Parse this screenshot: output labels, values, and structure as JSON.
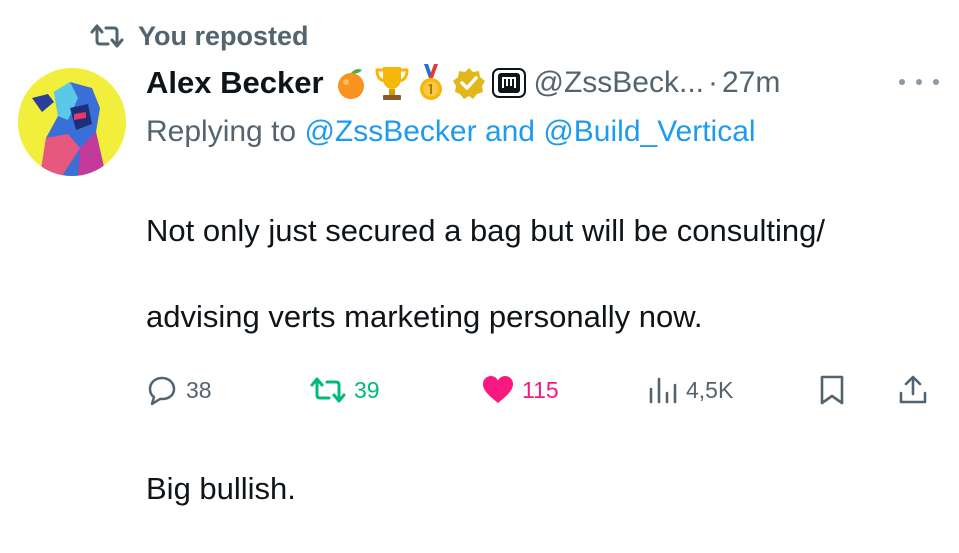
{
  "repost_banner": {
    "icon": "repost-icon",
    "label": "You reposted"
  },
  "tweet": {
    "author": {
      "name": "Alex Becker",
      "handle": "@ZssBeck...",
      "badges": [
        "orange-emoji",
        "trophy-emoji",
        "medal-emoji",
        "verified-badge",
        "affiliate-badge"
      ]
    },
    "dot": "·",
    "time": "27m",
    "replying": {
      "prefix": "Replying to",
      "user1": "@ZssBecker",
      "conjunction": "and",
      "user2": "@Build_Vertical"
    },
    "text_line1": "Not only just secured a bag but will be consulting/",
    "text_line2": "advising verts marketing personally now.",
    "text_line3": "Big bullish."
  },
  "actions": {
    "replies": "38",
    "reposts": "39",
    "likes": "115",
    "views": "4,5K"
  },
  "colors": {
    "secondary_text": "#536471",
    "link": "#1d9bf0",
    "repost_active": "#00ba7c",
    "like_active": "#f91880"
  }
}
